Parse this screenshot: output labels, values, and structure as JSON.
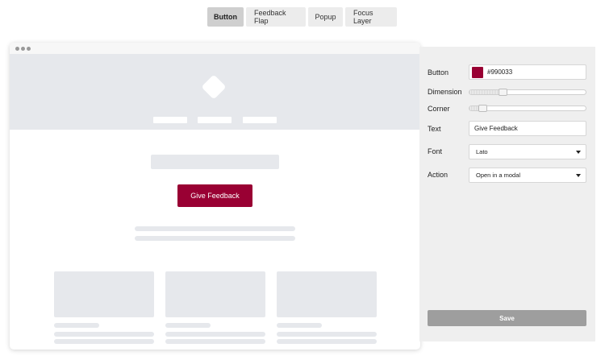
{
  "tabs": [
    {
      "label": "Button",
      "active": true
    },
    {
      "label": "Feedback Flap",
      "active": false
    },
    {
      "label": "Popup",
      "active": false
    },
    {
      "label": "Focus Layer",
      "active": false
    }
  ],
  "preview": {
    "button_label": "Give Feedback",
    "button_color": "#990033"
  },
  "settings": {
    "button_label": "Button",
    "button_color_value": "#990033",
    "dimension_label": "Dimension",
    "dimension_fraction": 0.27,
    "corner_label": "Corner",
    "corner_fraction": 0.08,
    "text_label": "Text",
    "text_value": "Give Feedback",
    "font_label": "Font",
    "font_value": "Lato",
    "action_label": "Action",
    "action_value": "Open in a modal",
    "save_label": "Save"
  },
  "colors": {
    "accent": "#990033",
    "placeholder": "#e6e8ec",
    "save_button": "#9e9e9e"
  }
}
